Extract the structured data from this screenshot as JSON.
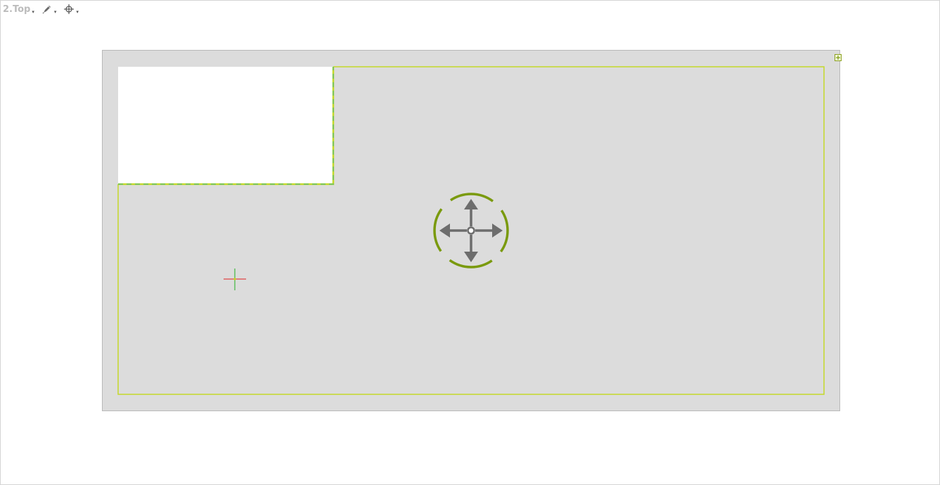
{
  "viewport": {
    "name": "2.Top",
    "name_caret": "▾"
  },
  "toolbar": {
    "draw_tool_icon": "pen-icon",
    "draw_tool_caret": "▾",
    "snap_tool_icon": "crosshair-target-icon",
    "snap_tool_caret": "▾"
  },
  "canvas": {
    "background_color": "#dcdcdc",
    "selection_color": "#c3d82a",
    "dashed_edge_color": "#7cc65a",
    "handle_color": "#7a9a0e",
    "arrow_color": "#6d6d6d",
    "origin_x_color": "#e02020",
    "origin_y_color": "#20b020"
  }
}
